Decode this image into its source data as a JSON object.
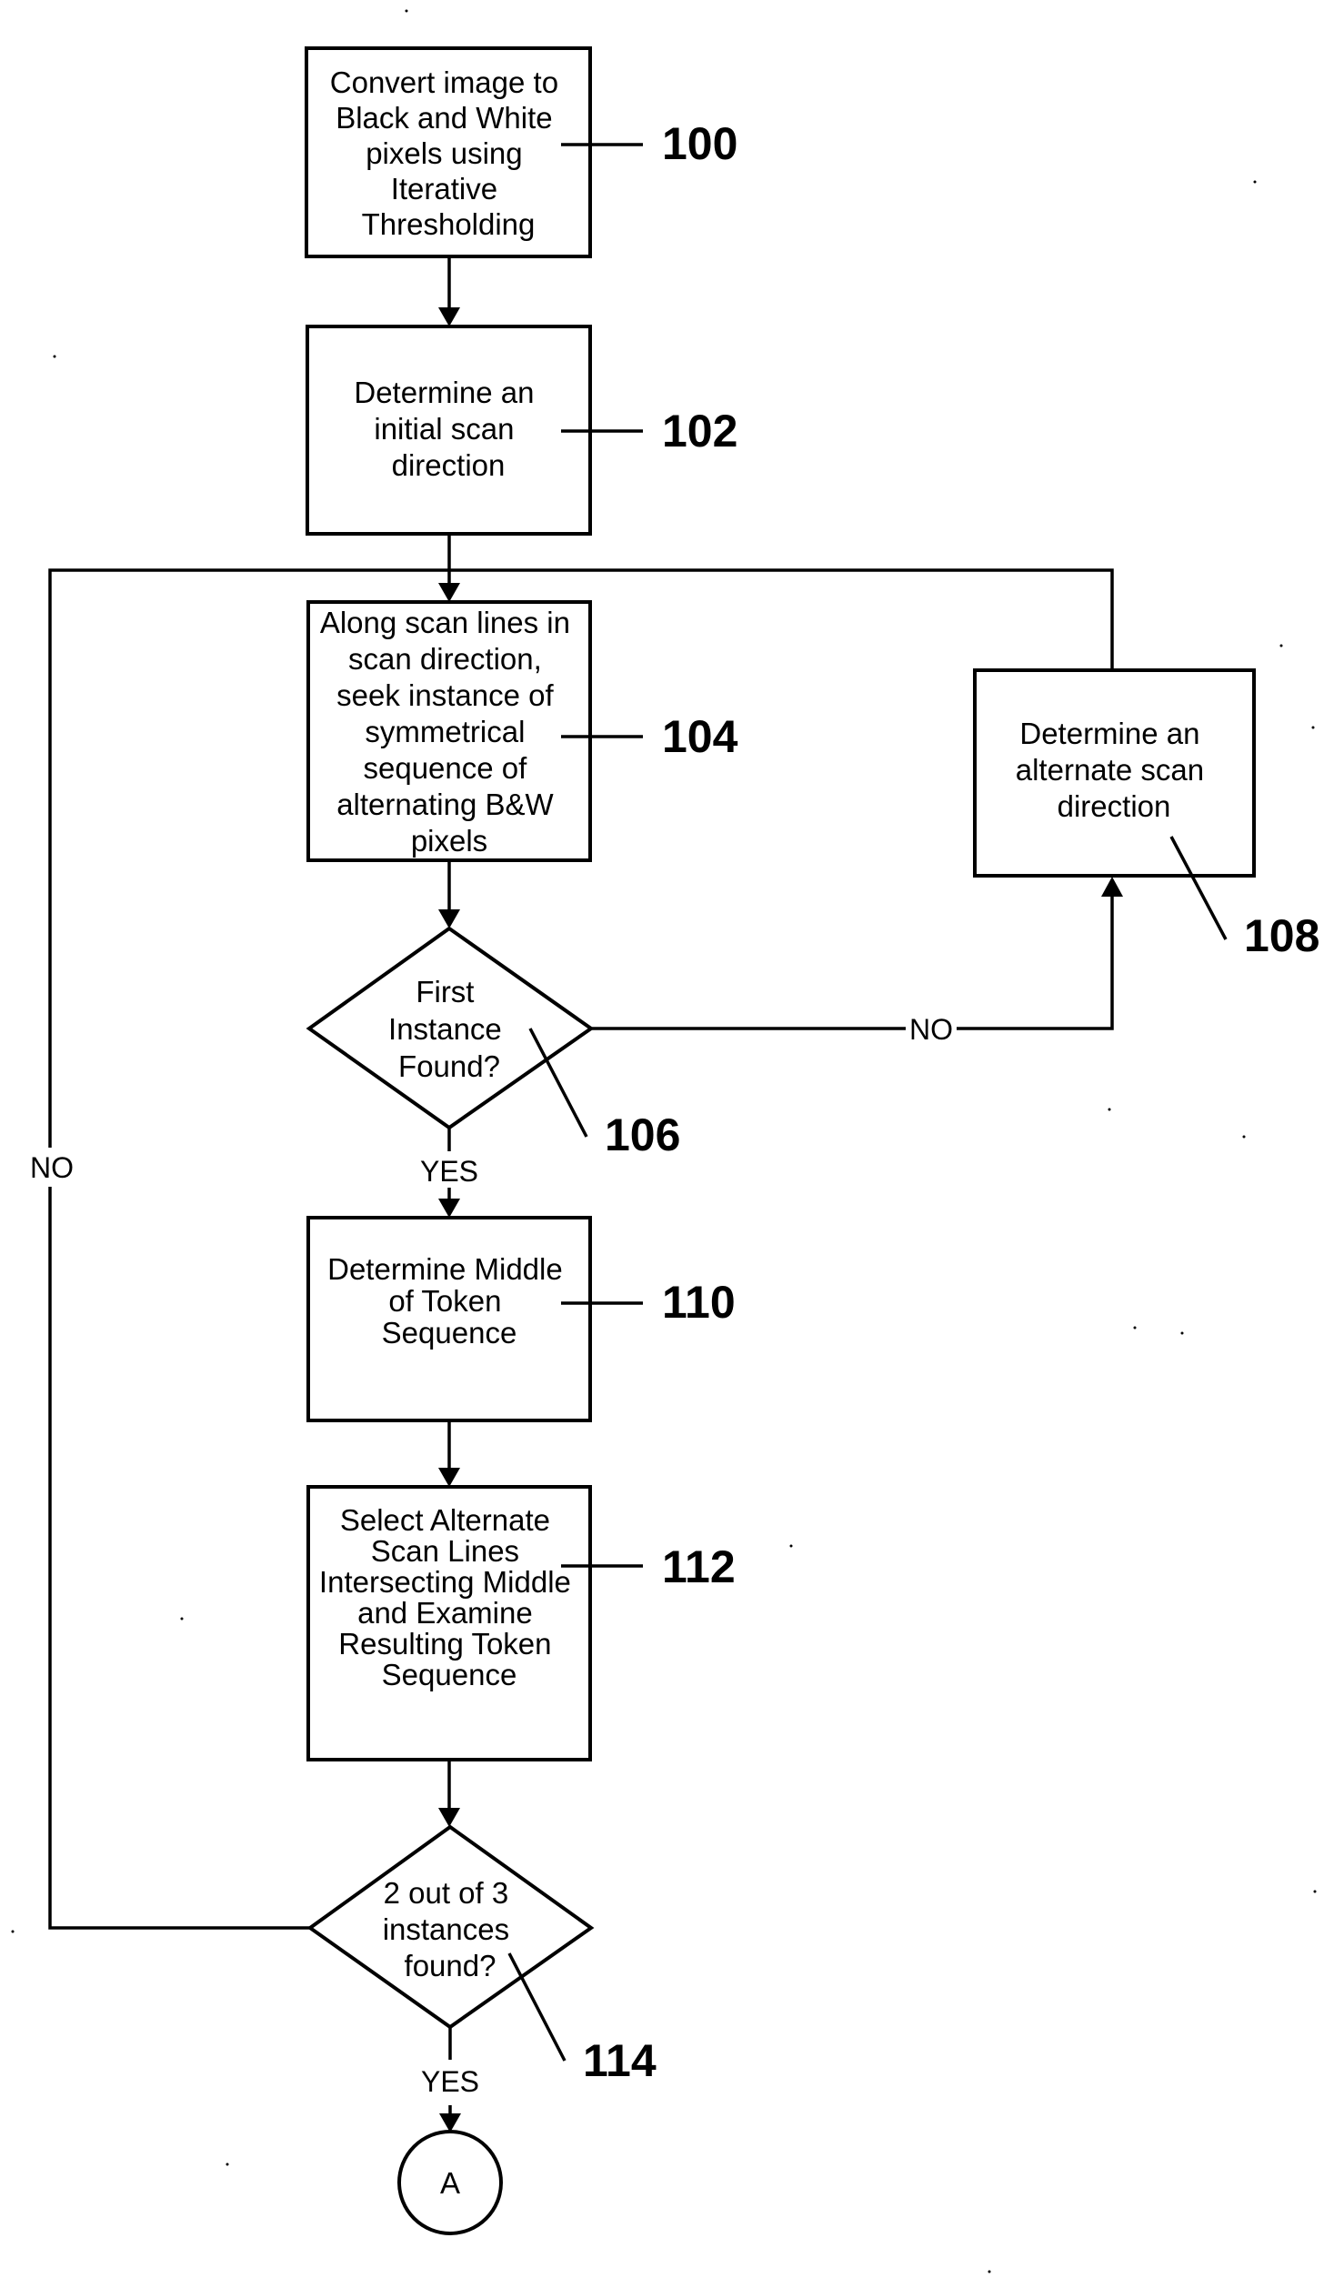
{
  "diagram": {
    "type": "flowchart",
    "nodes": [
      {
        "id": "100",
        "shape": "process",
        "lines": [
          "Convert image to",
          "Black and White",
          "pixels using",
          "Iterative",
          "Thresholding"
        ],
        "ref": "100"
      },
      {
        "id": "102",
        "shape": "process",
        "lines": [
          "Determine an",
          "initial scan",
          "direction"
        ],
        "ref": "102"
      },
      {
        "id": "104",
        "shape": "process",
        "lines": [
          "Along scan lines in",
          "scan direction,",
          "seek instance of",
          "symmetrical",
          "sequence of",
          "alternating B&W",
          "pixels"
        ],
        "ref": "104"
      },
      {
        "id": "106",
        "shape": "decision",
        "lines": [
          "First",
          "Instance",
          "Found?"
        ],
        "ref": "106"
      },
      {
        "id": "108",
        "shape": "process",
        "lines": [
          "Determine an",
          "alternate scan",
          "direction"
        ],
        "ref": "108"
      },
      {
        "id": "110",
        "shape": "process",
        "lines": [
          "Determine Middle",
          "of Token",
          "Sequence"
        ],
        "ref": "110"
      },
      {
        "id": "112",
        "shape": "process",
        "lines": [
          "Select Alternate",
          "Scan Lines",
          "Intersecting Middle",
          "and Examine",
          "Resulting Token",
          "Sequence"
        ],
        "ref": "112"
      },
      {
        "id": "114",
        "shape": "decision",
        "lines": [
          "2 out of 3",
          "instances",
          "found?"
        ],
        "ref": "114"
      },
      {
        "id": "A",
        "shape": "connector",
        "lines": [
          "A"
        ]
      }
    ],
    "edges": [
      {
        "from": "100",
        "to": "102",
        "label": ""
      },
      {
        "from": "102",
        "to": "104",
        "label": ""
      },
      {
        "from": "104",
        "to": "106",
        "label": ""
      },
      {
        "from": "106",
        "to": "108",
        "label": "NO"
      },
      {
        "from": "108",
        "to": "104",
        "label": ""
      },
      {
        "from": "106",
        "to": "110",
        "label": "YES"
      },
      {
        "from": "110",
        "to": "112",
        "label": ""
      },
      {
        "from": "112",
        "to": "114",
        "label": ""
      },
      {
        "from": "114",
        "to": "104",
        "label": "NO"
      },
      {
        "from": "114",
        "to": "A",
        "label": "YES"
      }
    ],
    "colors": {
      "ink": "#000000",
      "paper": "#ffffff"
    }
  }
}
